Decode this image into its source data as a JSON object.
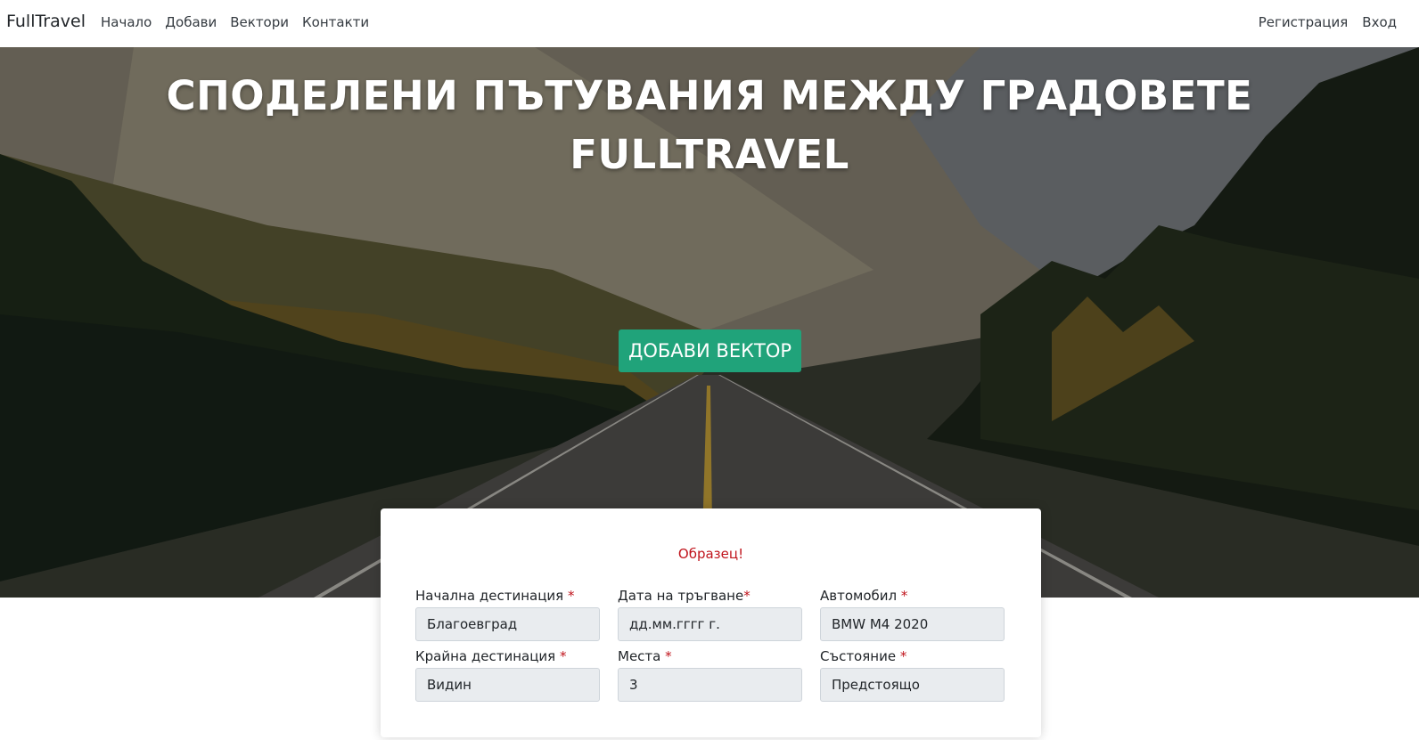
{
  "navbar": {
    "brand": "FullTravel",
    "links": [
      "Начало",
      "Добави",
      "Вектори",
      "Контакти"
    ],
    "right_links": [
      "Регистрация",
      "Вход"
    ]
  },
  "hero": {
    "title_line1": "СПОДЕЛЕНИ ПЪТУВАНИЯ МЕЖДУ ГРАДОВЕТЕ",
    "title_line2": "FULLTRAVEL",
    "button_label": "ДОБАВИ ВЕКТОР"
  },
  "card": {
    "sample_label": "Образец!",
    "fields": [
      {
        "label": "Начална дестинация",
        "required_mark": "*",
        "value": "Благоевград"
      },
      {
        "label": "Дата на тръгване",
        "required_mark": "*",
        "value": "дд.мм.гггг г."
      },
      {
        "label": "Автомобил",
        "required_mark": "*",
        "value": "BMW M4 2020"
      },
      {
        "label": "Крайна дестинация",
        "required_mark": "*",
        "value": "Видин"
      },
      {
        "label": "Места",
        "required_mark": "*",
        "value": "3"
      },
      {
        "label": "Състояние",
        "required_mark": "*",
        "value": "Предстоящо"
      }
    ]
  },
  "colors": {
    "accent_button": "#20a37a",
    "required_red": "#c0141c",
    "input_bg": "#e9ecef"
  }
}
